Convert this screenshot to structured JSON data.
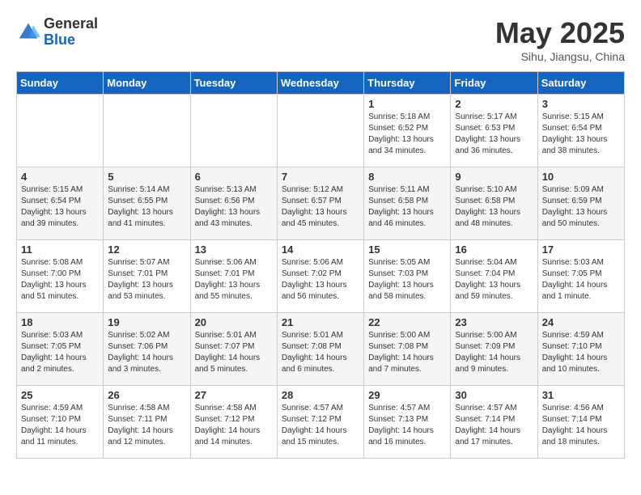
{
  "header": {
    "logo_general": "General",
    "logo_blue": "Blue",
    "month_title": "May 2025",
    "location": "Sihu, Jiangsu, China"
  },
  "days_of_week": [
    "Sunday",
    "Monday",
    "Tuesday",
    "Wednesday",
    "Thursday",
    "Friday",
    "Saturday"
  ],
  "weeks": [
    [
      {
        "day": "",
        "info": ""
      },
      {
        "day": "",
        "info": ""
      },
      {
        "day": "",
        "info": ""
      },
      {
        "day": "",
        "info": ""
      },
      {
        "day": "1",
        "info": "Sunrise: 5:18 AM\nSunset: 6:52 PM\nDaylight: 13 hours\nand 34 minutes."
      },
      {
        "day": "2",
        "info": "Sunrise: 5:17 AM\nSunset: 6:53 PM\nDaylight: 13 hours\nand 36 minutes."
      },
      {
        "day": "3",
        "info": "Sunrise: 5:15 AM\nSunset: 6:54 PM\nDaylight: 13 hours\nand 38 minutes."
      }
    ],
    [
      {
        "day": "4",
        "info": "Sunrise: 5:15 AM\nSunset: 6:54 PM\nDaylight: 13 hours\nand 39 minutes."
      },
      {
        "day": "5",
        "info": "Sunrise: 5:14 AM\nSunset: 6:55 PM\nDaylight: 13 hours\nand 41 minutes."
      },
      {
        "day": "6",
        "info": "Sunrise: 5:13 AM\nSunset: 6:56 PM\nDaylight: 13 hours\nand 43 minutes."
      },
      {
        "day": "7",
        "info": "Sunrise: 5:12 AM\nSunset: 6:57 PM\nDaylight: 13 hours\nand 45 minutes."
      },
      {
        "day": "8",
        "info": "Sunrise: 5:11 AM\nSunset: 6:58 PM\nDaylight: 13 hours\nand 46 minutes."
      },
      {
        "day": "9",
        "info": "Sunrise: 5:10 AM\nSunset: 6:58 PM\nDaylight: 13 hours\nand 48 minutes."
      },
      {
        "day": "10",
        "info": "Sunrise: 5:09 AM\nSunset: 6:59 PM\nDaylight: 13 hours\nand 50 minutes."
      }
    ],
    [
      {
        "day": "11",
        "info": "Sunrise: 5:08 AM\nSunset: 7:00 PM\nDaylight: 13 hours\nand 51 minutes."
      },
      {
        "day": "12",
        "info": "Sunrise: 5:07 AM\nSunset: 7:01 PM\nDaylight: 13 hours\nand 53 minutes."
      },
      {
        "day": "13",
        "info": "Sunrise: 5:06 AM\nSunset: 7:01 PM\nDaylight: 13 hours\nand 55 minutes."
      },
      {
        "day": "14",
        "info": "Sunrise: 5:06 AM\nSunset: 7:02 PM\nDaylight: 13 hours\nand 56 minutes."
      },
      {
        "day": "15",
        "info": "Sunrise: 5:05 AM\nSunset: 7:03 PM\nDaylight: 13 hours\nand 58 minutes."
      },
      {
        "day": "16",
        "info": "Sunrise: 5:04 AM\nSunset: 7:04 PM\nDaylight: 13 hours\nand 59 minutes."
      },
      {
        "day": "17",
        "info": "Sunrise: 5:03 AM\nSunset: 7:05 PM\nDaylight: 14 hours\nand 1 minute."
      }
    ],
    [
      {
        "day": "18",
        "info": "Sunrise: 5:03 AM\nSunset: 7:05 PM\nDaylight: 14 hours\nand 2 minutes."
      },
      {
        "day": "19",
        "info": "Sunrise: 5:02 AM\nSunset: 7:06 PM\nDaylight: 14 hours\nand 3 minutes."
      },
      {
        "day": "20",
        "info": "Sunrise: 5:01 AM\nSunset: 7:07 PM\nDaylight: 14 hours\nand 5 minutes."
      },
      {
        "day": "21",
        "info": "Sunrise: 5:01 AM\nSunset: 7:08 PM\nDaylight: 14 hours\nand 6 minutes."
      },
      {
        "day": "22",
        "info": "Sunrise: 5:00 AM\nSunset: 7:08 PM\nDaylight: 14 hours\nand 7 minutes."
      },
      {
        "day": "23",
        "info": "Sunrise: 5:00 AM\nSunset: 7:09 PM\nDaylight: 14 hours\nand 9 minutes."
      },
      {
        "day": "24",
        "info": "Sunrise: 4:59 AM\nSunset: 7:10 PM\nDaylight: 14 hours\nand 10 minutes."
      }
    ],
    [
      {
        "day": "25",
        "info": "Sunrise: 4:59 AM\nSunset: 7:10 PM\nDaylight: 14 hours\nand 11 minutes."
      },
      {
        "day": "26",
        "info": "Sunrise: 4:58 AM\nSunset: 7:11 PM\nDaylight: 14 hours\nand 12 minutes."
      },
      {
        "day": "27",
        "info": "Sunrise: 4:58 AM\nSunset: 7:12 PM\nDaylight: 14 hours\nand 14 minutes."
      },
      {
        "day": "28",
        "info": "Sunrise: 4:57 AM\nSunset: 7:12 PM\nDaylight: 14 hours\nand 15 minutes."
      },
      {
        "day": "29",
        "info": "Sunrise: 4:57 AM\nSunset: 7:13 PM\nDaylight: 14 hours\nand 16 minutes."
      },
      {
        "day": "30",
        "info": "Sunrise: 4:57 AM\nSunset: 7:14 PM\nDaylight: 14 hours\nand 17 minutes."
      },
      {
        "day": "31",
        "info": "Sunrise: 4:56 AM\nSunset: 7:14 PM\nDaylight: 14 hours\nand 18 minutes."
      }
    ]
  ]
}
